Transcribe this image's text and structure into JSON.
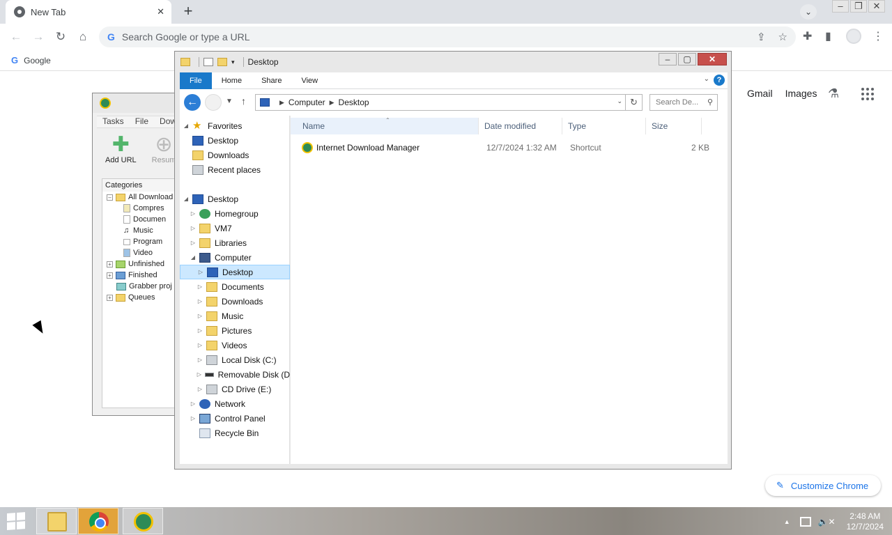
{
  "browser": {
    "tab_title": "New Tab",
    "tab_close": "✕",
    "new_tab": "+",
    "omnibox_placeholder": "Search Google or type a URL",
    "bookmark_label": "Google",
    "ntp_gmail": "Gmail",
    "ntp_images": "Images",
    "customize_label": "Customize Chrome"
  },
  "idm": {
    "menu": [
      "Tasks",
      "File",
      "Downl"
    ],
    "tools": [
      "Add URL",
      "Resum"
    ],
    "categories_title": "Categories",
    "tree": [
      "All Download",
      "Compres",
      "Documen",
      "Music",
      "Program",
      "Video",
      "Unfinished",
      "Finished",
      "Grabber proj",
      "Queues"
    ]
  },
  "explorer": {
    "title": "Desktop",
    "ribbon_tabs": [
      "File",
      "Home",
      "Share",
      "View"
    ],
    "help": "?",
    "breadcrumb": [
      "Computer",
      "Desktop"
    ],
    "search_placeholder": "Search De...",
    "nav": {
      "favorites": "Favorites",
      "fav_desktop": "Desktop",
      "fav_downloads": "Downloads",
      "fav_recent": "Recent places",
      "desktop": "Desktop",
      "homegroup": "Homegroup",
      "vm7": "VM7",
      "libraries": "Libraries",
      "computer": "Computer",
      "comp_desktop": "Desktop",
      "comp_documents": "Documents",
      "comp_downloads": "Downloads",
      "comp_music": "Music",
      "comp_pictures": "Pictures",
      "comp_videos": "Videos",
      "local_disk": "Local Disk (C:)",
      "removable": "Removable Disk (D",
      "cd_drive": "CD Drive (E:)",
      "network": "Network",
      "control_panel": "Control Panel",
      "recycle_bin": "Recycle Bin"
    },
    "columns": [
      "Name",
      "Date modified",
      "Type",
      "Size"
    ],
    "files": [
      {
        "name": "Internet Download Manager",
        "date": "12/7/2024 1:32 AM",
        "type": "Shortcut",
        "size": "2 KB"
      }
    ]
  },
  "taskbar": {
    "time": "2:48 AM",
    "date": "12/7/2024"
  }
}
